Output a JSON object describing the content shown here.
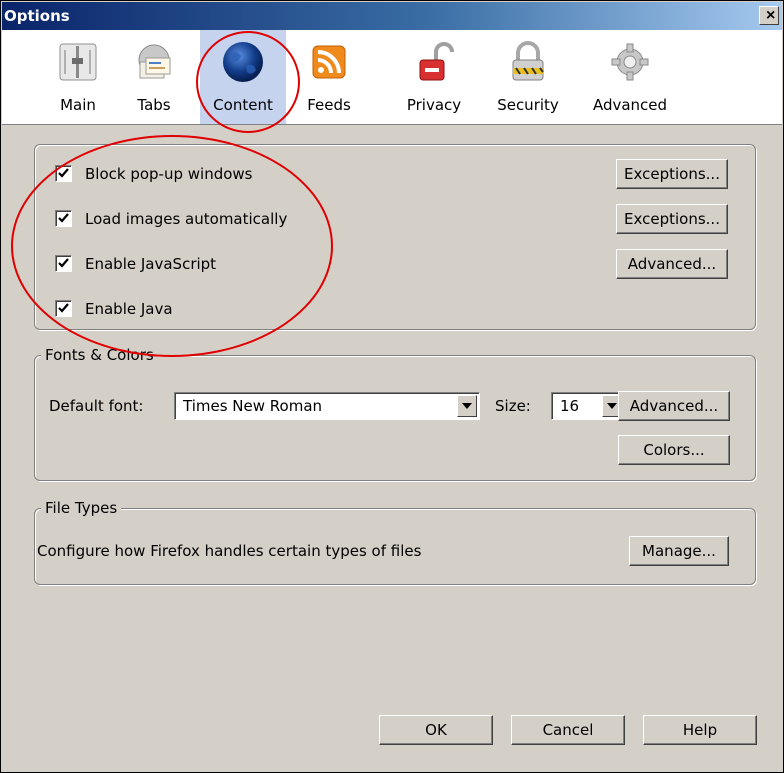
{
  "window": {
    "title": "Options",
    "close_glyph": "×"
  },
  "tabs": [
    {
      "label": "Main",
      "icon": "switch-icon",
      "selected": false
    },
    {
      "label": "Tabs",
      "icon": "tabs-icon",
      "selected": false
    },
    {
      "label": "Content",
      "icon": "globe-icon",
      "selected": true
    },
    {
      "label": "Feeds",
      "icon": "rss-feed-icon",
      "selected": false
    },
    {
      "label": "Privacy",
      "icon": "padlock-icon",
      "selected": false
    },
    {
      "label": "Security",
      "icon": "lock-icon",
      "selected": false
    },
    {
      "label": "Advanced",
      "icon": "gear-icon",
      "selected": false
    }
  ],
  "content": {
    "checks": [
      {
        "label": "Block pop-up windows",
        "checked": true,
        "button": "Exceptions..."
      },
      {
        "label": "Load images automatically",
        "checked": true,
        "button": "Exceptions..."
      },
      {
        "label": "Enable JavaScript",
        "checked": true,
        "button": "Advanced..."
      },
      {
        "label": "Enable Java",
        "checked": true,
        "button": ""
      }
    ]
  },
  "fonts": {
    "legend": "Fonts & Colors",
    "default_font_label": "Default font:",
    "default_font_value": "Times New Roman",
    "size_label": "Size:",
    "size_value": "16",
    "advanced_button": "Advanced...",
    "colors_button": "Colors..."
  },
  "file_types": {
    "legend": "File Types",
    "description": "Configure how Firefox handles certain types of files",
    "manage_button": "Manage..."
  },
  "footer": {
    "ok": "OK",
    "cancel": "Cancel",
    "help": "Help"
  },
  "colors": {
    "annotation": "#e00000",
    "selected_tab": "#c5d3ee",
    "dialog_bg": "#d4d0c8"
  }
}
